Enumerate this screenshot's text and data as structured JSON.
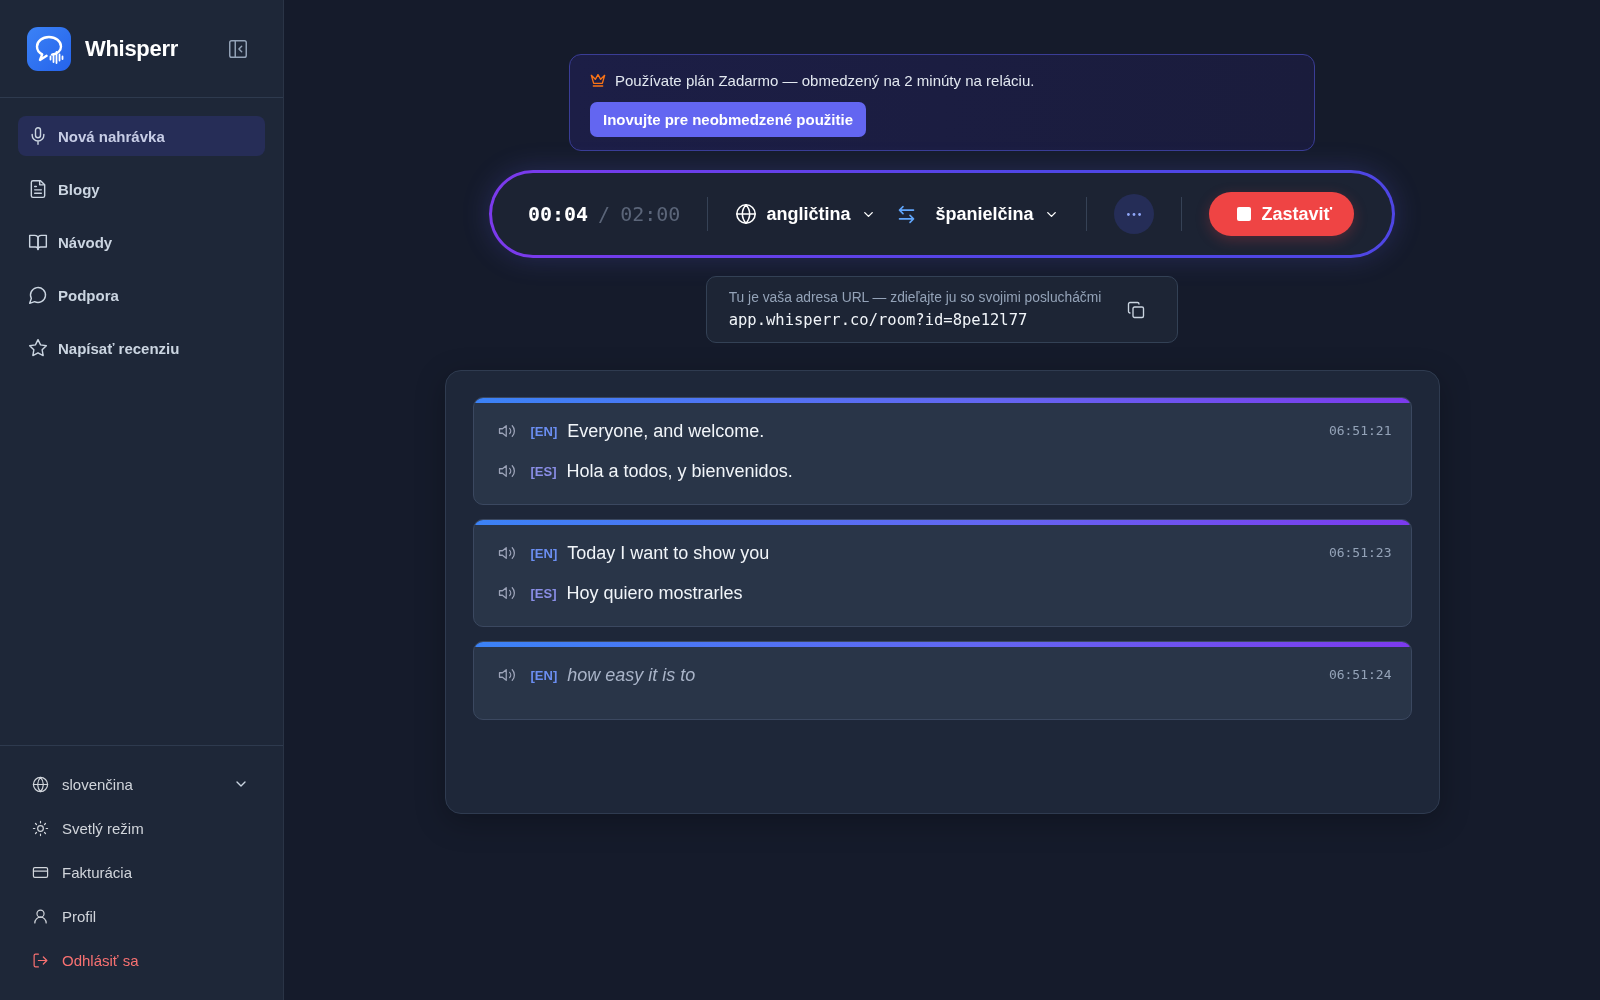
{
  "sidebar": {
    "brand": "Whisperr",
    "nav": [
      {
        "label": "Nová nahrávka",
        "selected": true
      },
      {
        "label": "Blogy",
        "selected": false
      },
      {
        "label": "Návody",
        "selected": false
      },
      {
        "label": "Podpora",
        "selected": false
      },
      {
        "label": "Napísať recenziu",
        "selected": false
      }
    ],
    "footer": [
      {
        "kind": "select",
        "label": "slovenčina"
      },
      {
        "kind": "link",
        "label": "Svetlý režim"
      },
      {
        "kind": "link",
        "label": "Fakturácia"
      },
      {
        "kind": "link",
        "label": "Profil"
      },
      {
        "kind": "danger",
        "label": "Odhlásiť sa"
      }
    ]
  },
  "plan_banner": {
    "text": "Používate plán Zadarmo — obmedzený na 2 minúty na reláciu.",
    "button": "Inovujte pre neobmedzené použitie"
  },
  "recorder": {
    "elapsed": "00:04",
    "separator": "/",
    "limit": "02:00",
    "source_language": "angličtina",
    "target_language": "španielčina",
    "stop_button": "Zastaviť"
  },
  "share_url": {
    "label": "Tu je vaša adresa URL — zdieľajte ju so svojimi poslucháčmi",
    "url": "app.whisperr.co/room?id=8pe12l77"
  },
  "transcript": [
    {
      "time": "06:51:21",
      "interim": false,
      "lines": [
        {
          "tag": "[EN]",
          "color": "#6b8ef2",
          "text": "Everyone, and welcome."
        },
        {
          "tag": "[ES]",
          "color": "#8a8ee6",
          "text": "Hola a todos, y bienvenidos."
        }
      ]
    },
    {
      "time": "06:51:23",
      "interim": false,
      "lines": [
        {
          "tag": "[EN]",
          "color": "#6b8ef2",
          "text": "Today I want to show you"
        },
        {
          "tag": "[ES]",
          "color": "#8a8ee6",
          "text": "Hoy quiero mostrarles"
        }
      ]
    },
    {
      "time": "06:51:24",
      "interim": true,
      "lines": [
        {
          "tag": "[EN]",
          "color": "#6b8ef2",
          "text": "how easy it is to"
        }
      ]
    }
  ]
}
